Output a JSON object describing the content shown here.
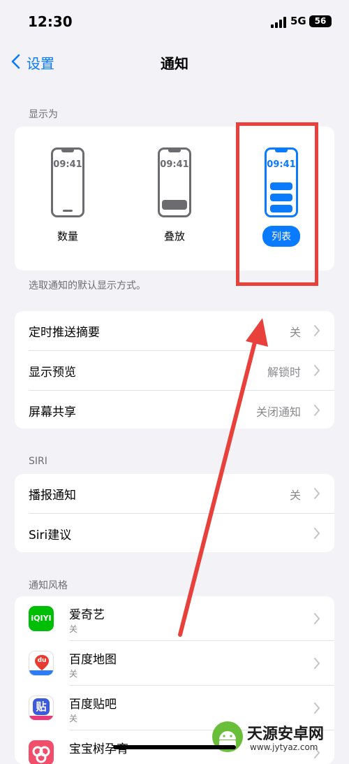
{
  "status_bar": {
    "time": "12:30",
    "network": "5G",
    "battery": "56"
  },
  "nav": {
    "back_label": "设置",
    "title": "通知"
  },
  "display_as": {
    "header": "显示为",
    "phone_time": "09:41",
    "options": [
      {
        "label": "数量",
        "selected": false
      },
      {
        "label": "叠放",
        "selected": false
      },
      {
        "label": "列表",
        "selected": true
      }
    ],
    "footer": "选取通知的默认显示方式。"
  },
  "settings_group": {
    "rows": [
      {
        "label": "定时推送摘要",
        "value": "关"
      },
      {
        "label": "显示预览",
        "value": "解锁时"
      },
      {
        "label": "屏幕共享",
        "value": "关闭通知"
      }
    ]
  },
  "siri": {
    "header": "SIRI",
    "rows": [
      {
        "label": "播报通知",
        "value": "关"
      },
      {
        "label": "Siri建议",
        "value": ""
      }
    ]
  },
  "notification_style": {
    "header": "通知风格",
    "apps": [
      {
        "name": "爱奇艺",
        "status": "关",
        "icon_text": "iQIYI",
        "icon_color": "#00be06"
      },
      {
        "name": "百度地图",
        "status": "关",
        "icon_text": "du",
        "icon_color": "#ffffff"
      },
      {
        "name": "百度贴吧",
        "status": "关",
        "icon_text": "贴",
        "icon_color": "#ffffff"
      },
      {
        "name": "宝宝树孕育",
        "status": "",
        "icon_text": "",
        "icon_color": "#f04e6b"
      }
    ]
  },
  "watermark": {
    "name": "天源安卓网",
    "url": "www.jytyaz.com"
  },
  "colors": {
    "accent": "#0a7aff",
    "annotation": "#e8403a",
    "background": "#f2f2f7"
  }
}
